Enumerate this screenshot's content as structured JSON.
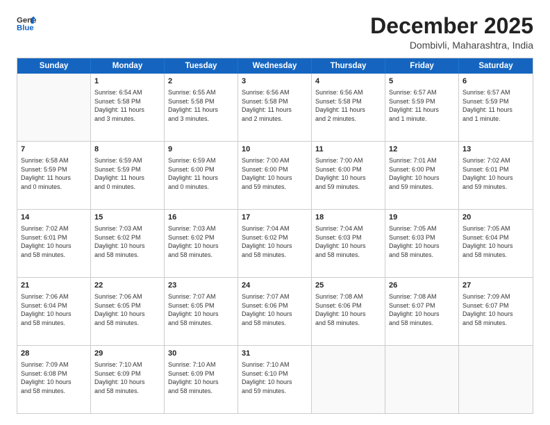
{
  "logo": {
    "line1": "General",
    "line2": "Blue"
  },
  "title": "December 2025",
  "subtitle": "Dombivli, Maharashtra, India",
  "header_days": [
    "Sunday",
    "Monday",
    "Tuesday",
    "Wednesday",
    "Thursday",
    "Friday",
    "Saturday"
  ],
  "weeks": [
    [
      {
        "day": "",
        "info": ""
      },
      {
        "day": "1",
        "info": "Sunrise: 6:54 AM\nSunset: 5:58 PM\nDaylight: 11 hours\nand 3 minutes."
      },
      {
        "day": "2",
        "info": "Sunrise: 6:55 AM\nSunset: 5:58 PM\nDaylight: 11 hours\nand 3 minutes."
      },
      {
        "day": "3",
        "info": "Sunrise: 6:56 AM\nSunset: 5:58 PM\nDaylight: 11 hours\nand 2 minutes."
      },
      {
        "day": "4",
        "info": "Sunrise: 6:56 AM\nSunset: 5:58 PM\nDaylight: 11 hours\nand 2 minutes."
      },
      {
        "day": "5",
        "info": "Sunrise: 6:57 AM\nSunset: 5:59 PM\nDaylight: 11 hours\nand 1 minute."
      },
      {
        "day": "6",
        "info": "Sunrise: 6:57 AM\nSunset: 5:59 PM\nDaylight: 11 hours\nand 1 minute."
      }
    ],
    [
      {
        "day": "7",
        "info": "Sunrise: 6:58 AM\nSunset: 5:59 PM\nDaylight: 11 hours\nand 0 minutes."
      },
      {
        "day": "8",
        "info": "Sunrise: 6:59 AM\nSunset: 5:59 PM\nDaylight: 11 hours\nand 0 minutes."
      },
      {
        "day": "9",
        "info": "Sunrise: 6:59 AM\nSunset: 6:00 PM\nDaylight: 11 hours\nand 0 minutes."
      },
      {
        "day": "10",
        "info": "Sunrise: 7:00 AM\nSunset: 6:00 PM\nDaylight: 10 hours\nand 59 minutes."
      },
      {
        "day": "11",
        "info": "Sunrise: 7:00 AM\nSunset: 6:00 PM\nDaylight: 10 hours\nand 59 minutes."
      },
      {
        "day": "12",
        "info": "Sunrise: 7:01 AM\nSunset: 6:00 PM\nDaylight: 10 hours\nand 59 minutes."
      },
      {
        "day": "13",
        "info": "Sunrise: 7:02 AM\nSunset: 6:01 PM\nDaylight: 10 hours\nand 59 minutes."
      }
    ],
    [
      {
        "day": "14",
        "info": "Sunrise: 7:02 AM\nSunset: 6:01 PM\nDaylight: 10 hours\nand 58 minutes."
      },
      {
        "day": "15",
        "info": "Sunrise: 7:03 AM\nSunset: 6:02 PM\nDaylight: 10 hours\nand 58 minutes."
      },
      {
        "day": "16",
        "info": "Sunrise: 7:03 AM\nSunset: 6:02 PM\nDaylight: 10 hours\nand 58 minutes."
      },
      {
        "day": "17",
        "info": "Sunrise: 7:04 AM\nSunset: 6:02 PM\nDaylight: 10 hours\nand 58 minutes."
      },
      {
        "day": "18",
        "info": "Sunrise: 7:04 AM\nSunset: 6:03 PM\nDaylight: 10 hours\nand 58 minutes."
      },
      {
        "day": "19",
        "info": "Sunrise: 7:05 AM\nSunset: 6:03 PM\nDaylight: 10 hours\nand 58 minutes."
      },
      {
        "day": "20",
        "info": "Sunrise: 7:05 AM\nSunset: 6:04 PM\nDaylight: 10 hours\nand 58 minutes."
      }
    ],
    [
      {
        "day": "21",
        "info": "Sunrise: 7:06 AM\nSunset: 6:04 PM\nDaylight: 10 hours\nand 58 minutes."
      },
      {
        "day": "22",
        "info": "Sunrise: 7:06 AM\nSunset: 6:05 PM\nDaylight: 10 hours\nand 58 minutes."
      },
      {
        "day": "23",
        "info": "Sunrise: 7:07 AM\nSunset: 6:05 PM\nDaylight: 10 hours\nand 58 minutes."
      },
      {
        "day": "24",
        "info": "Sunrise: 7:07 AM\nSunset: 6:06 PM\nDaylight: 10 hours\nand 58 minutes."
      },
      {
        "day": "25",
        "info": "Sunrise: 7:08 AM\nSunset: 6:06 PM\nDaylight: 10 hours\nand 58 minutes."
      },
      {
        "day": "26",
        "info": "Sunrise: 7:08 AM\nSunset: 6:07 PM\nDaylight: 10 hours\nand 58 minutes."
      },
      {
        "day": "27",
        "info": "Sunrise: 7:09 AM\nSunset: 6:07 PM\nDaylight: 10 hours\nand 58 minutes."
      }
    ],
    [
      {
        "day": "28",
        "info": "Sunrise: 7:09 AM\nSunset: 6:08 PM\nDaylight: 10 hours\nand 58 minutes."
      },
      {
        "day": "29",
        "info": "Sunrise: 7:10 AM\nSunset: 6:09 PM\nDaylight: 10 hours\nand 58 minutes."
      },
      {
        "day": "30",
        "info": "Sunrise: 7:10 AM\nSunset: 6:09 PM\nDaylight: 10 hours\nand 58 minutes."
      },
      {
        "day": "31",
        "info": "Sunrise: 7:10 AM\nSunset: 6:10 PM\nDaylight: 10 hours\nand 59 minutes."
      },
      {
        "day": "",
        "info": ""
      },
      {
        "day": "",
        "info": ""
      },
      {
        "day": "",
        "info": ""
      }
    ]
  ]
}
